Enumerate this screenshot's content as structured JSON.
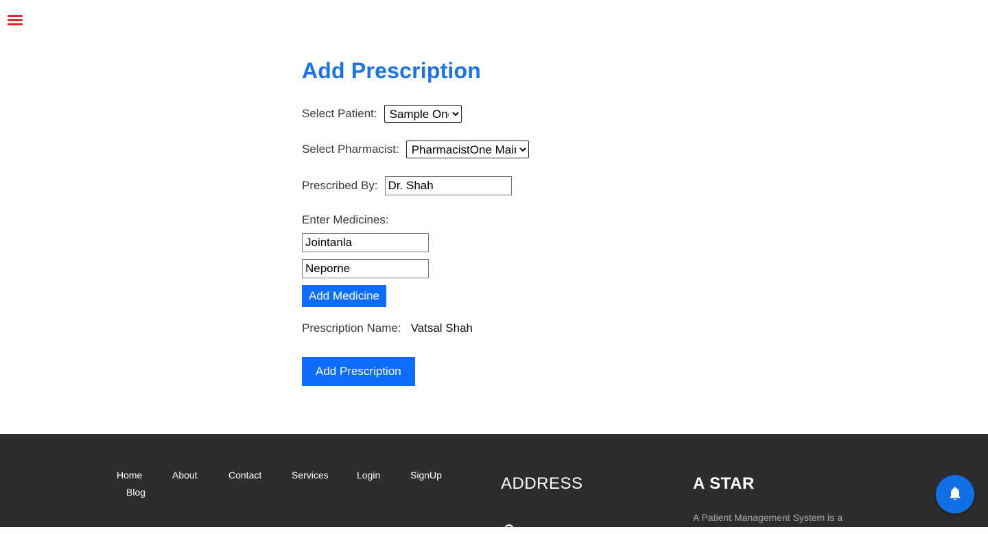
{
  "menu": {
    "icon": "hamburger-menu-icon",
    "color": "#e8262d"
  },
  "form": {
    "title": "Add Prescription",
    "patient": {
      "label": "Select Patient:",
      "selected": "Sample One"
    },
    "pharmacist": {
      "label": "Select Pharmacist:",
      "selected": "PharmacistOne Main"
    },
    "prescribed_by": {
      "label": "Prescribed By:",
      "value": "Dr. Shah"
    },
    "medicines": {
      "label": "Enter Medicines:",
      "items": [
        "Jointanla",
        "Neporne"
      ],
      "add_button": "Add Medicine"
    },
    "prescription_name": {
      "label": "Prescription Name:",
      "value": "Vatsal Shah"
    },
    "submit_button": "Add Prescription"
  },
  "colors": {
    "accent": "#1a73e8",
    "button": "#0d6efd",
    "footer_bg": "#2d2d2d",
    "notify_bg": "#1170e6"
  },
  "footer": {
    "nav": [
      "Home",
      "About",
      "Contact",
      "Services",
      "Login",
      "SignUp",
      "Blog"
    ],
    "address_title": "ADDRESS",
    "address_icon": "map-pin-icon",
    "brand_title": "A STAR",
    "brand_desc": "A Patient Management System is a"
  },
  "notification": {
    "icon": "bell-icon"
  }
}
